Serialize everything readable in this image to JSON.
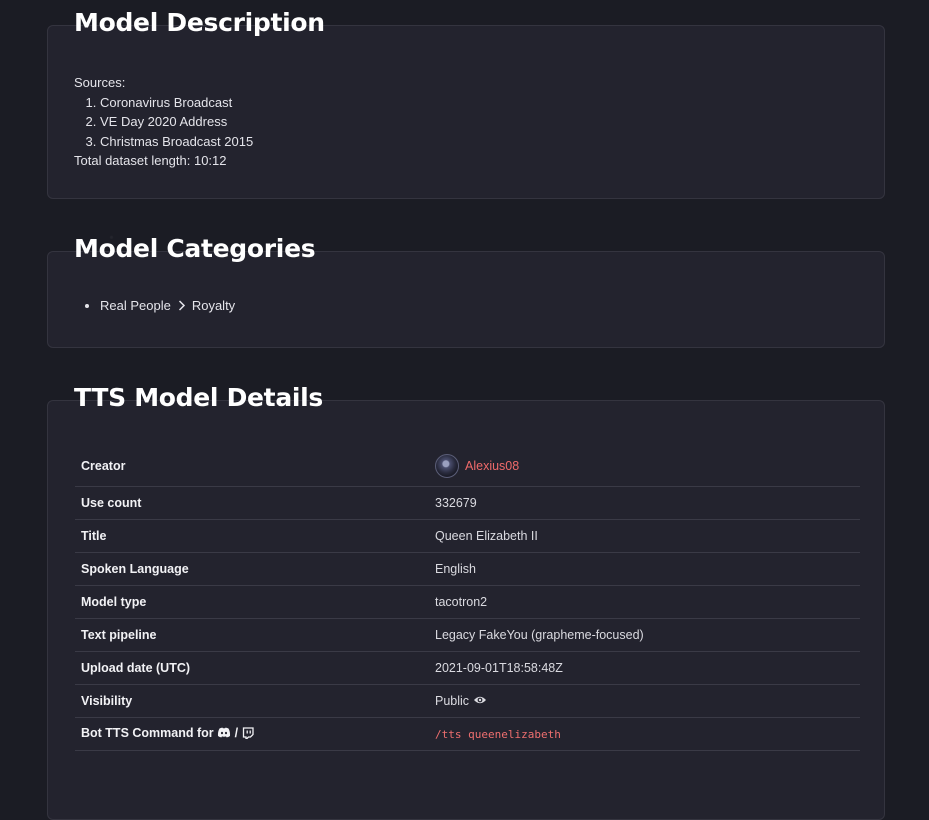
{
  "description": {
    "title": "Model Description",
    "sources_label": "Sources:",
    "sources": [
      "Coronavirus Broadcast",
      "VE Day 2020 Address",
      "Christmas Broadcast 2015"
    ],
    "total_length": "Total dataset length: 10:12"
  },
  "categories": {
    "title": "Model Categories",
    "items": [
      {
        "parent": "Real People",
        "child": "Royalty"
      }
    ]
  },
  "details": {
    "title": "TTS Model Details",
    "creator_label": "Creator",
    "creator_name": "Alexius08",
    "use_count_label": "Use count",
    "use_count": "332679",
    "title_label": "Title",
    "title_value": "Queen Elizabeth II",
    "language_label": "Spoken Language",
    "language_value": "English",
    "model_type_label": "Model type",
    "model_type_value": "tacotron2",
    "pipeline_label": "Text pipeline",
    "pipeline_value": "Legacy FakeYou (grapheme-focused)",
    "upload_label": "Upload date (UTC)",
    "upload_value": "2021-09-01T18:58:48Z",
    "visibility_label": "Visibility",
    "visibility_value": "Public",
    "bot_label": "Bot TTS Command for",
    "bot_separator": "/",
    "bot_command": "/tts queenelizabeth"
  },
  "icons": {
    "visibility": "eye-icon",
    "discord": "discord-icon",
    "twitch": "twitch-icon",
    "breadcrumb": "chevron-right-icon"
  },
  "colors": {
    "background": "#1b1c24",
    "panel": "#23232e",
    "link": "#f06a6a"
  }
}
